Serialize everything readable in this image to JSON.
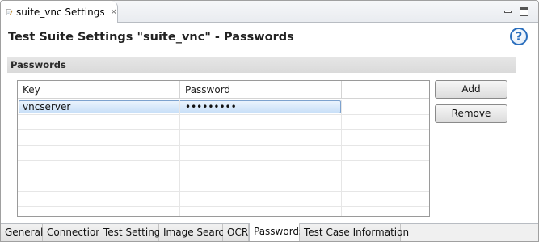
{
  "editor_tab": {
    "title": "suite_vnc Settings"
  },
  "page": {
    "title": "Test Suite Settings \"suite_vnc\" - Passwords"
  },
  "section": {
    "title": "Passwords"
  },
  "table": {
    "columns": [
      "Key",
      "Password",
      ""
    ],
    "rows": [
      {
        "key": "vncserver",
        "password": "•••••••••",
        "selected": true
      }
    ]
  },
  "buttons": {
    "add": "Add",
    "remove": "Remove"
  },
  "help": {
    "glyph": "?"
  },
  "bottom_tabs": [
    "General",
    "Connection",
    "Test Settings",
    "Image Search",
    "OCR",
    "Passwords",
    "Test Case Information"
  ],
  "active_bottom_tab": "Passwords",
  "colors": {
    "selection": "#c9e0f8",
    "selection_border": "#7da2ce",
    "help_blue": "#2a6ebd"
  }
}
